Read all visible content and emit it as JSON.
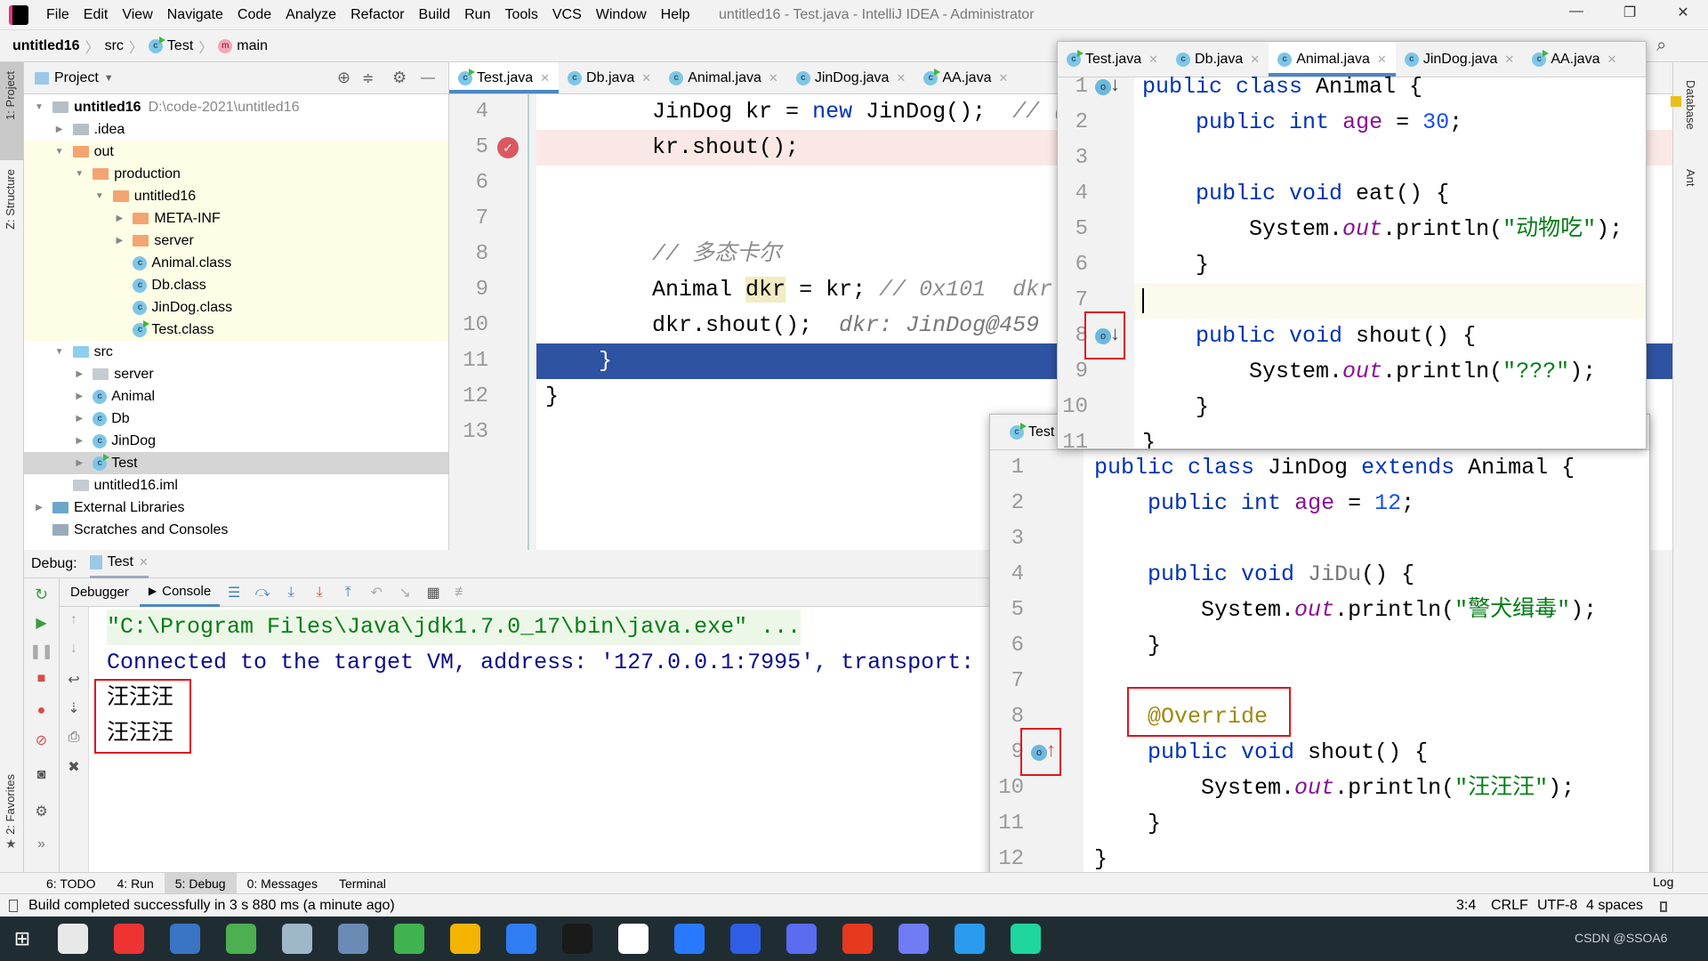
{
  "app": {
    "title": "untitled16 - Test.java - IntelliJ IDEA - Administrator"
  },
  "menu": [
    "File",
    "Edit",
    "View",
    "Navigate",
    "Code",
    "Analyze",
    "Refactor",
    "Build",
    "Run",
    "Tools",
    "VCS",
    "Window",
    "Help"
  ],
  "window_controls": {
    "minimize": "—",
    "restore": "❐",
    "close": "✕"
  },
  "breadcrumb": [
    "untitled16",
    "src",
    "Test",
    "main"
  ],
  "left_strip": {
    "project": "1: Project",
    "structure": "Z: Structure",
    "favorites": "2: Favorites"
  },
  "right_strip": {
    "database": "Database",
    "ant": "Ant"
  },
  "project": {
    "header": "Project",
    "tree": [
      {
        "label": "untitled16",
        "path": "D:\\code-2021\\untitled16",
        "level": 0,
        "arrow": "down",
        "icon": "module",
        "bold": true
      },
      {
        "label": ".idea",
        "level": 1,
        "arrow": "right",
        "icon": "folder-gray"
      },
      {
        "label": "out",
        "level": 1,
        "arrow": "down",
        "icon": "folder-orange",
        "yellow": true
      },
      {
        "label": "production",
        "level": 2,
        "arrow": "down",
        "icon": "folder-orange",
        "yellow": true
      },
      {
        "label": "untitled16",
        "level": 3,
        "arrow": "down",
        "icon": "folder-orange",
        "yellow": true
      },
      {
        "label": "META-INF",
        "level": 4,
        "arrow": "right",
        "icon": "folder-orange",
        "yellow": true
      },
      {
        "label": "server",
        "level": 4,
        "arrow": "right",
        "icon": "folder-orange",
        "yellow": true
      },
      {
        "label": "Animal.class",
        "level": 4,
        "icon": "class",
        "yellow": true
      },
      {
        "label": "Db.class",
        "level": 4,
        "icon": "class",
        "yellow": true
      },
      {
        "label": "JinDog.class",
        "level": 4,
        "icon": "class",
        "yellow": true
      },
      {
        "label": "Test.class",
        "level": 4,
        "icon": "class-run",
        "yellow": true
      },
      {
        "label": "src",
        "level": 1,
        "arrow": "down",
        "icon": "folder-blue"
      },
      {
        "label": "server",
        "level": 2,
        "arrow": "right",
        "icon": "package"
      },
      {
        "label": "Animal",
        "level": 2,
        "arrow": "right",
        "icon": "class"
      },
      {
        "label": "Db",
        "level": 2,
        "arrow": "right",
        "icon": "class"
      },
      {
        "label": "JinDog",
        "level": 2,
        "arrow": "right",
        "icon": "class"
      },
      {
        "label": "Test",
        "level": 2,
        "arrow": "right",
        "icon": "class-run",
        "selected": true
      },
      {
        "label": "untitled16.iml",
        "level": 1,
        "icon": "file"
      },
      {
        "label": "External Libraries",
        "level": 0,
        "arrow": "right",
        "icon": "library"
      },
      {
        "label": "Scratches and Consoles",
        "level": 0,
        "icon": "scratch"
      }
    ]
  },
  "editor": {
    "tabs": [
      {
        "label": "Test.java",
        "active": true,
        "run": true
      },
      {
        "label": "Db.java"
      },
      {
        "label": "Animal.java"
      },
      {
        "label": "JinDog.java"
      },
      {
        "label": "AA.java",
        "run": true
      }
    ],
    "lines": [
      {
        "n": "4",
        "tokens": [
          {
            "t": "        JinDog kr = "
          },
          {
            "t": "new",
            "c": "kw"
          },
          {
            "t": " JinDog();  "
          },
          {
            "t": "// (",
            "c": "cmt"
          }
        ]
      },
      {
        "n": "5",
        "breakpoint": true,
        "tokens": [
          {
            "t": "        kr.shout();"
          }
        ]
      },
      {
        "n": "6",
        "tokens": []
      },
      {
        "n": "7",
        "tokens": []
      },
      {
        "n": "8",
        "tokens": [
          {
            "t": "        "
          },
          {
            "t": "// 多态卡尔",
            "c": "cmt"
          }
        ]
      },
      {
        "n": "9",
        "tokens": [
          {
            "t": "        Animal "
          },
          {
            "t": "dkr",
            "c": "hl"
          },
          {
            "t": " = kr; "
          },
          {
            "t": "// 0x101  dkr",
            "c": "cmt"
          }
        ]
      },
      {
        "n": "10",
        "tokens": [
          {
            "t": "        dkr.shout();  "
          },
          {
            "t": "dkr: JinDog@459",
            "c": "hint"
          }
        ]
      },
      {
        "n": "11",
        "current": true,
        "tokens": [
          {
            "t": "    }"
          }
        ]
      },
      {
        "n": "12",
        "tokens": [
          {
            "t": "}"
          }
        ]
      },
      {
        "n": "13",
        "tokens": []
      }
    ]
  },
  "animal_popup": {
    "tabs": [
      {
        "label": "Test.java",
        "run": true
      },
      {
        "label": "Db.java"
      },
      {
        "label": "Animal.java",
        "active": true
      },
      {
        "label": "JinDog.java"
      },
      {
        "label": "AA.java",
        "run": true
      }
    ],
    "lines": [
      {
        "n": "1",
        "icon": "overridden",
        "tokens": [
          {
            "t": "public class",
            "c": "kw"
          },
          {
            "t": " Animal {"
          }
        ]
      },
      {
        "n": "2",
        "tokens": [
          {
            "t": "    "
          },
          {
            "t": "public int",
            "c": "kw"
          },
          {
            "t": " "
          },
          {
            "t": "age",
            "c": "fld"
          },
          {
            "t": " = "
          },
          {
            "t": "30",
            "c": "num"
          },
          {
            "t": ";"
          }
        ]
      },
      {
        "n": "3",
        "tokens": []
      },
      {
        "n": "4",
        "tokens": [
          {
            "t": "    "
          },
          {
            "t": "public void",
            "c": "kw"
          },
          {
            "t": " eat() {"
          }
        ]
      },
      {
        "n": "5",
        "tokens": [
          {
            "t": "        System."
          },
          {
            "t": "out",
            "c": "ital"
          },
          {
            "t": ".println("
          },
          {
            "t": "\"动物吃\"",
            "c": "str"
          },
          {
            "t": ");"
          }
        ]
      },
      {
        "n": "6",
        "tokens": [
          {
            "t": "    }"
          }
        ]
      },
      {
        "n": "7",
        "caret": true,
        "tokens": []
      },
      {
        "n": "8",
        "icon": "overridden",
        "boxed": true,
        "tokens": [
          {
            "t": "    "
          },
          {
            "t": "public void",
            "c": "kw"
          },
          {
            "t": " shout() {"
          }
        ]
      },
      {
        "n": "9",
        "tokens": [
          {
            "t": "        System."
          },
          {
            "t": "out",
            "c": "ital"
          },
          {
            "t": ".println("
          },
          {
            "t": "\"???\"",
            "c": "str"
          },
          {
            "t": ");"
          }
        ]
      },
      {
        "n": "10",
        "tokens": [
          {
            "t": "    }"
          }
        ]
      },
      {
        "n": "11",
        "tokens": [
          {
            "t": "}"
          }
        ]
      }
    ]
  },
  "jindog_popup": {
    "tab": "Test",
    "lines": [
      {
        "n": "1",
        "tokens": [
          {
            "t": "public class",
            "c": "kw"
          },
          {
            "t": " JinDog "
          },
          {
            "t": "extends",
            "c": "kw"
          },
          {
            "t": " Animal {"
          }
        ]
      },
      {
        "n": "2",
        "tokens": [
          {
            "t": "    "
          },
          {
            "t": "public int",
            "c": "kw"
          },
          {
            "t": " "
          },
          {
            "t": "age",
            "c": "fld"
          },
          {
            "t": " = "
          },
          {
            "t": "12",
            "c": "num"
          },
          {
            "t": ";"
          }
        ]
      },
      {
        "n": "3",
        "tokens": []
      },
      {
        "n": "4",
        "tokens": [
          {
            "t": "    "
          },
          {
            "t": "public void",
            "c": "kw"
          },
          {
            "t": " "
          },
          {
            "t": "JiDu",
            "c": "unused"
          },
          {
            "t": "() {"
          }
        ]
      },
      {
        "n": "5",
        "tokens": [
          {
            "t": "        System."
          },
          {
            "t": "out",
            "c": "ital"
          },
          {
            "t": ".println("
          },
          {
            "t": "\"警犬缉毒\"",
            "c": "str"
          },
          {
            "t": ");"
          }
        ]
      },
      {
        "n": "6",
        "tokens": [
          {
            "t": "    }"
          }
        ]
      },
      {
        "n": "7",
        "tokens": []
      },
      {
        "n": "8",
        "tokens": [
          {
            "t": "    "
          },
          {
            "t": "@Override",
            "c": "ann"
          }
        ]
      },
      {
        "n": "9",
        "icon": "overrides",
        "boxed": true,
        "tokens": [
          {
            "t": "    "
          },
          {
            "t": "public void",
            "c": "kw"
          },
          {
            "t": " shout() {"
          }
        ]
      },
      {
        "n": "10",
        "tokens": [
          {
            "t": "        System."
          },
          {
            "t": "out",
            "c": "ital"
          },
          {
            "t": ".println("
          },
          {
            "t": "\"汪汪汪\"",
            "c": "str"
          },
          {
            "t": ");"
          }
        ]
      },
      {
        "n": "11",
        "tokens": [
          {
            "t": "    }"
          }
        ]
      },
      {
        "n": "12",
        "tokens": [
          {
            "t": "}"
          }
        ]
      }
    ]
  },
  "debug": {
    "label": "Debug:",
    "session_tab": "Test",
    "debugger_tab": "Debugger",
    "console_tab": "Console",
    "console": [
      {
        "text": "\"C:\\Program Files\\Java\\jdk1.7.0_17\\bin\\java.exe\" ...",
        "color": "#067d17",
        "bg": "#edf7e8"
      },
      {
        "text": "Connected to the target VM, address: '127.0.0.1:7995', transport:",
        "color": "#0b0b8c"
      },
      {
        "text": "汪汪汪",
        "color": "#000"
      },
      {
        "text": "汪汪汪",
        "color": "#000"
      }
    ]
  },
  "bottom_tabs": [
    {
      "label": "6: TODO"
    },
    {
      "label": "4: Run"
    },
    {
      "label": "5: Debug",
      "active": true
    },
    {
      "label": "0: Messages"
    },
    {
      "label": "Terminal"
    }
  ],
  "event_log": "Log",
  "status": {
    "message": "Build completed successfully in 3 s 880 ms (a minute ago)",
    "position": "3:4",
    "line_sep": "CRLF",
    "encoding": "UTF-8",
    "indent": "4 spaces"
  },
  "taskbar": {
    "apps": [
      "#e8e8e8",
      "#e33",
      "#3a74c4",
      "#4caf50",
      "#9fb8c9",
      "#6a8bb5",
      "#3eb34f",
      "#f4b400",
      "#2f7df2",
      "#1a1a1a",
      "#fff",
      "#2979ff",
      "#2f5de3",
      "#5b6cf0",
      "#e6391e",
      "#6f7cf3",
      "#2b9bf0",
      "#1ed69e"
    ],
    "watermark": "CSDN @SSOA6"
  },
  "colors": {
    "accent": "#4a88c7",
    "selection": "#2f53a3",
    "breakpoint": "#db5860",
    "annotation_box": "#e0141e"
  }
}
